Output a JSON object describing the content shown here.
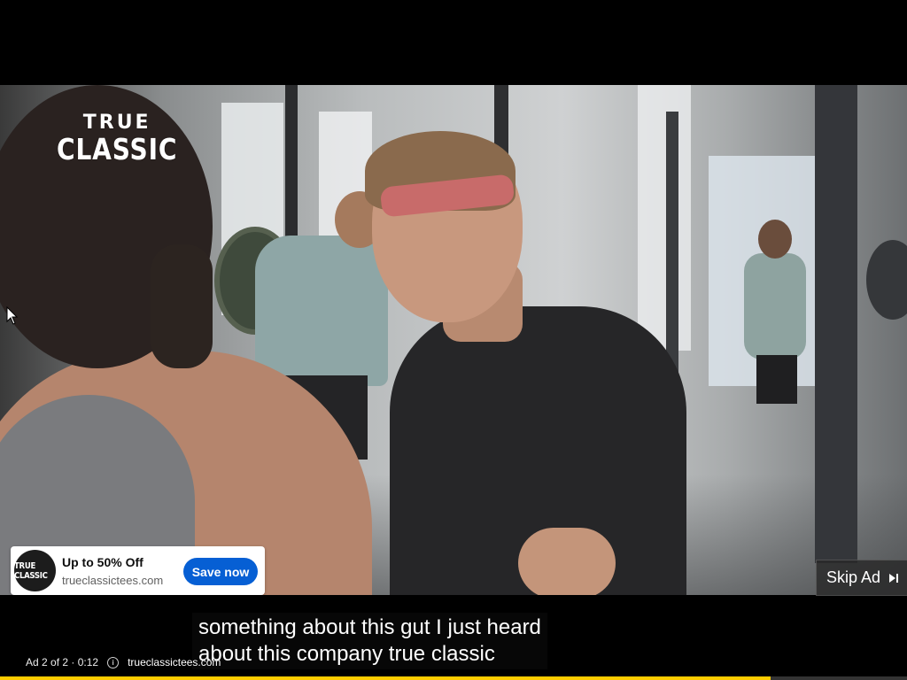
{
  "brand_logo": {
    "line1": "TRUE",
    "line2": "CLASSIC"
  },
  "ad_card": {
    "avatar_text": "TRUE CLASSIC",
    "title": "Up to 50% Off",
    "domain": "trueclassictees.com",
    "cta_label": "Save now",
    "cta_color": "#065fd4"
  },
  "skip": {
    "label": "Skip Ad",
    "icon": "skip-next-icon"
  },
  "captions": {
    "line1": "something about this gut I just heard",
    "line2": "about this company true classic"
  },
  "ad_info": {
    "counter": "Ad 2 of 2 · 0:12",
    "info_icon": "info-icon",
    "domain": "trueclassictees.com"
  },
  "progress": {
    "fraction": 0.85,
    "color": "#ffcc00"
  }
}
